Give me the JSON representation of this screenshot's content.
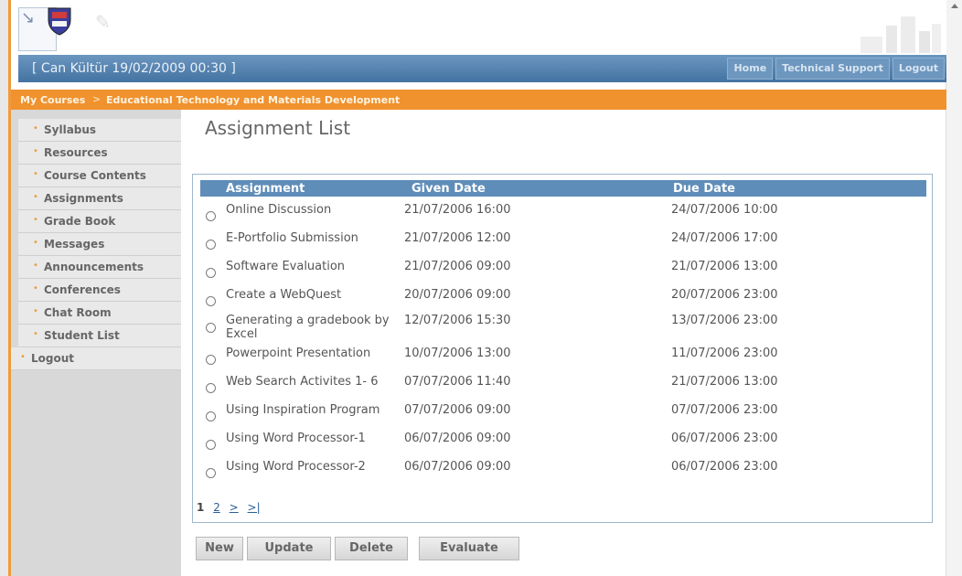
{
  "header": {
    "user_line": "[ Can Kültür  19/02/2009 00:30 ]",
    "links": [
      "Home",
      "Technical Support",
      "Logout"
    ]
  },
  "breadcrumb": {
    "items": [
      "My Courses",
      "Educational Technology and Materials Development"
    ],
    "separator": ">"
  },
  "sidebar": {
    "items": [
      {
        "label": "Syllabus"
      },
      {
        "label": "Resources"
      },
      {
        "label": "Course Contents"
      },
      {
        "label": "Assignments"
      },
      {
        "label": "Grade Book"
      },
      {
        "label": "Messages"
      },
      {
        "label": "Announcements"
      },
      {
        "label": "Conferences"
      },
      {
        "label": "Chat Room"
      },
      {
        "label": "Student List"
      }
    ],
    "logout_label": "Logout",
    "bullet": "•"
  },
  "main": {
    "title": "Assignment List",
    "columns": [
      "Assignment",
      "Given Date",
      "Due Date"
    ],
    "rows": [
      {
        "name": "Online Discussion",
        "given": "21/07/2006 16:00",
        "due": "24/07/2006 10:00"
      },
      {
        "name": "E-Portfolio Submission",
        "given": "21/07/2006 12:00",
        "due": "24/07/2006 17:00"
      },
      {
        "name": "Software Evaluation",
        "given": "21/07/2006 09:00",
        "due": "21/07/2006 13:00"
      },
      {
        "name": "Create a WebQuest",
        "given": "20/07/2006 09:00",
        "due": "20/07/2006 23:00"
      },
      {
        "name": "Generating a gradebook by Excel",
        "given": "12/07/2006 15:30",
        "due": "13/07/2006 23:00"
      },
      {
        "name": "Powerpoint Presentation",
        "given": "10/07/2006 13:00",
        "due": "11/07/2006 23:00"
      },
      {
        "name": "Web Search Activites 1- 6",
        "given": "07/07/2006 11:40",
        "due": "21/07/2006 13:00"
      },
      {
        "name": "Using Inspiration Program",
        "given": "07/07/2006 09:00",
        "due": "07/07/2006 23:00"
      },
      {
        "name": "Using Word Processor-1",
        "given": "06/07/2006 09:00",
        "due": "06/07/2006 23:00"
      },
      {
        "name": "Using Word Processor-2",
        "given": "06/07/2006 09:00",
        "due": "06/07/2006 23:00"
      }
    ],
    "pager": {
      "current": "1",
      "next_page": "2",
      "next": ">",
      "last": ">|"
    }
  },
  "actions": {
    "new": "New",
    "update": "Update",
    "delete": "Delete",
    "evaluate": "Evaluate"
  },
  "colors": {
    "title_bar": "#4f7fad",
    "breadcrumb_bar": "#f0922e",
    "table_header": "#5f8db9",
    "sidebar_bullet": "#f29a3a"
  }
}
